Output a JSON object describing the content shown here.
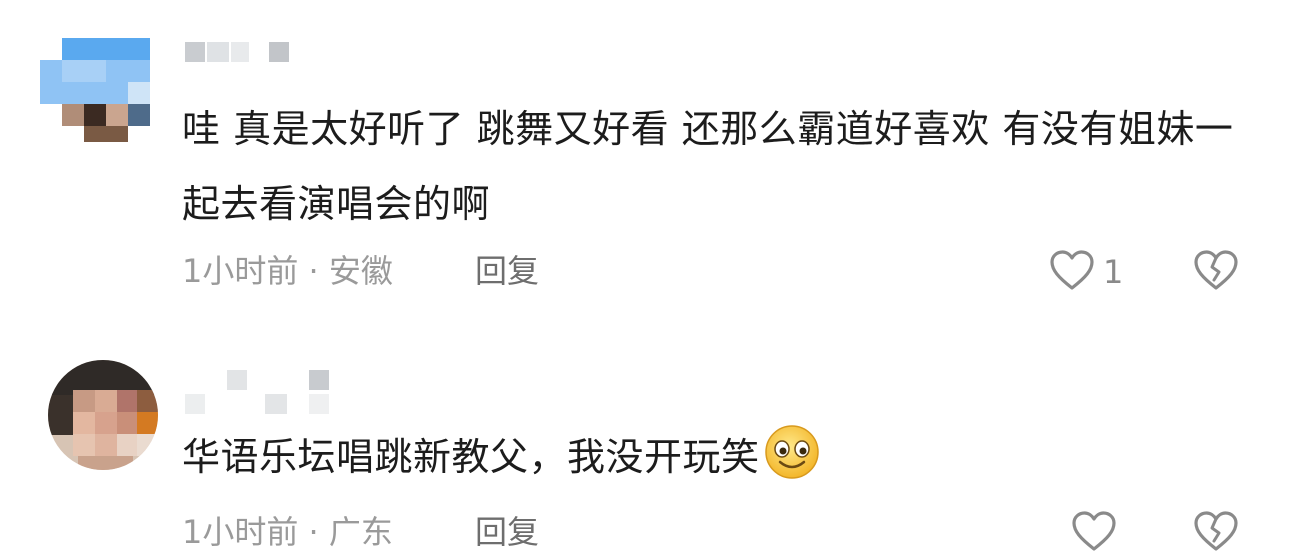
{
  "comments": [
    {
      "text": "哇 真是太好听了 跳舞又好看 还那么霸道好喜欢 有没有姐妹一起去看演唱会的啊",
      "time_location": "1小时前 · 安徽",
      "reply_label": "回复",
      "like_count": "1",
      "icons": {
        "like": "heart-outline-icon",
        "dislike": "broken-heart-icon"
      }
    },
    {
      "text": "华语乐坛唱跳新教父，我没开玩笑",
      "emoji": "smiling-face-emoji",
      "time_location": "1小时前 · 广东",
      "reply_label": "回复",
      "like_count": "",
      "icons": {
        "like": "heart-outline-icon",
        "dislike": "broken-heart-icon"
      }
    }
  ],
  "colors": {
    "text": "#1c1c1c",
    "meta": "#9a9a9a",
    "reply": "#6e6e6e",
    "icon": "#8a8a8a"
  }
}
